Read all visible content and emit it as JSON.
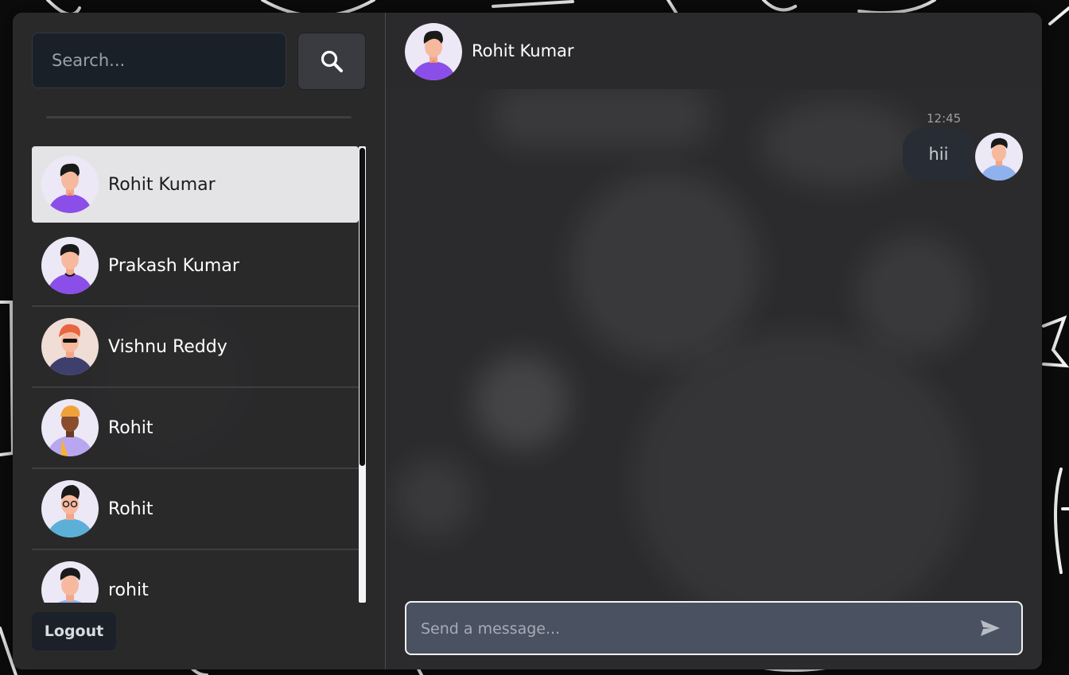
{
  "search": {
    "placeholder": "Search..."
  },
  "contacts": [
    {
      "name": "Rohit Kumar",
      "active": true
    },
    {
      "name": "Prakash Kumar",
      "active": false
    },
    {
      "name": "Vishnu Reddy",
      "active": false
    },
    {
      "name": "Rohit",
      "active": false
    },
    {
      "name": "Rohit",
      "active": false
    },
    {
      "name": "rohit",
      "active": false
    }
  ],
  "logout_label": "Logout",
  "chat": {
    "title": "Rohit Kumar",
    "messages": [
      {
        "time": "12:45",
        "text": "hii"
      }
    ],
    "input_placeholder": "Send a message..."
  },
  "icons": {
    "search": "search-icon",
    "send": "send-icon",
    "avatar": "avatar-illustration"
  },
  "colors": {
    "active_contact": "#e4e4e6",
    "message_box": "#4a5160",
    "bubble": "#272c35"
  }
}
